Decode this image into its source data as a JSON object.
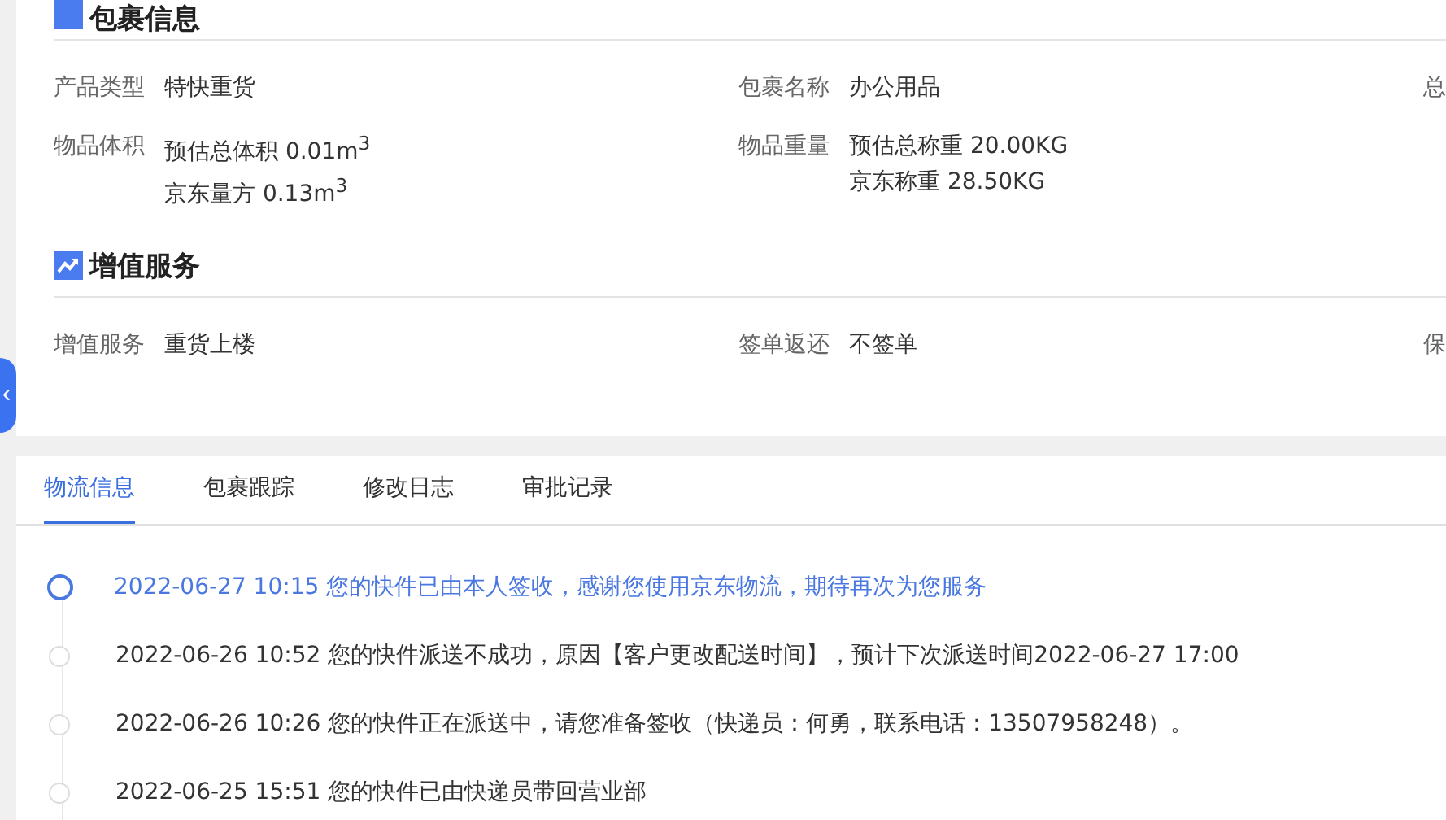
{
  "sections": [
    {
      "title": "包裹信息",
      "kind": "package",
      "rows": [
        [
          {
            "label": "产品类型",
            "lines": [
              "特快重货"
            ]
          },
          {
            "label": "包裹名称",
            "lines": [
              "办公用品"
            ]
          },
          {
            "label": "总"
          }
        ],
        [
          {
            "label": "物品体积",
            "lines": [
              "预估总体积 0.01m$^{3}$",
              "京东量方 0.13m$^{3}$"
            ]
          },
          {
            "label": "物品重量",
            "lines": [
              "预估总称重 20.00KG",
              "京东称重 28.50KG"
            ]
          }
        ]
      ]
    },
    {
      "title": "增值服务",
      "kind": "service",
      "rows": [
        [
          {
            "label": "增值服务",
            "lines": [
              "重货上楼"
            ]
          },
          {
            "label": "签单返还",
            "lines": [
              "不签单"
            ]
          },
          {
            "label": "保"
          }
        ]
      ]
    }
  ],
  "collapse_handle": "‹",
  "tabs": [
    {
      "label": "物流信息",
      "selected": true
    },
    {
      "label": "包裹跟踪",
      "selected": false
    },
    {
      "label": "修改日志",
      "selected": false
    },
    {
      "label": "审批记录",
      "selected": false
    }
  ],
  "timeline": [
    {
      "text": "2022-06-27 10:15 您的快件已由本人签收，感谢您使用京东物流，期待再次为您服务",
      "active": true
    },
    {
      "text": "2022-06-26 10:52 您的快件派送不成功，原因【客户更改配送时间】，预计下次派送时间2022-06-27 17:00",
      "active": false
    },
    {
      "text": "2022-06-26 10:26 您的快件正在派送中，请您准备签收（快递员：何勇，联系电话：13507958248）。",
      "active": false
    },
    {
      "text": "2022-06-25 15:51 您的快件已由快递员带回营业部",
      "active": false
    }
  ]
}
